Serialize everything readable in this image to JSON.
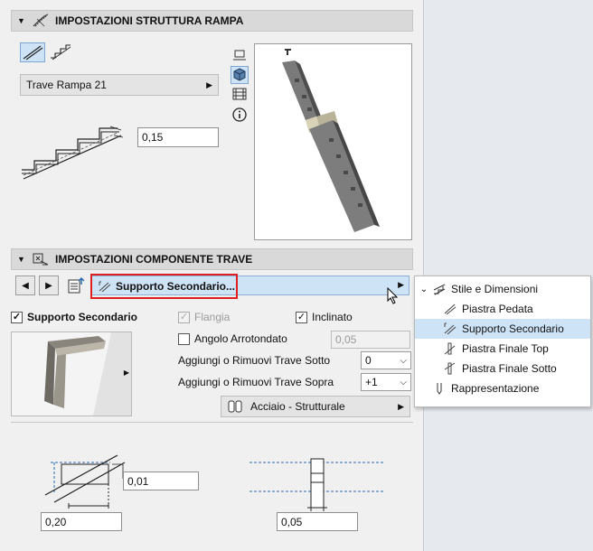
{
  "section1": {
    "title": "IMPOSTAZIONI STRUTTURA RAMPA",
    "preset_label": "Trave Rampa 21",
    "depth_value": "0,15"
  },
  "section2": {
    "title": "IMPOSTAZIONI COMPONENTE TRAVE",
    "component_select": "Supporto Secondario...",
    "highlight_color": "#e02020",
    "main_checkbox": {
      "label": "Supporto Secondario",
      "checked": true
    },
    "flangia": {
      "label": "Flangia",
      "checked": true,
      "disabled": true
    },
    "inclinato": {
      "label": "Inclinato",
      "checked": true
    },
    "angolo": {
      "label": "Angolo Arrotondato",
      "checked": false,
      "value": "0,05"
    },
    "trave_sotto": {
      "label": "Aggiungi o Rimuovi Trave Sotto",
      "value": "0"
    },
    "trave_sopra": {
      "label": "Aggiungi o Rimuovi Trave Sopra",
      "value": "+1"
    },
    "material": "Acciaio - Strutturale",
    "dim_top": "0,01",
    "dim_bottom_left": "0,20",
    "dim_bottom_right": "0,05"
  },
  "menu": {
    "header": "Stile e Dimensioni",
    "items": [
      {
        "label": "Piastra Pedata",
        "icon": "tread-plate-icon",
        "selected": false
      },
      {
        "label": "Supporto Secondario",
        "icon": "secondary-support-icon",
        "selected": true
      },
      {
        "label": "Piastra Finale Top",
        "icon": "end-plate-top-icon",
        "selected": false
      },
      {
        "label": "Piastra Finale Sotto",
        "icon": "end-plate-bottom-icon",
        "selected": false
      }
    ],
    "footer": "Rappresentazione"
  }
}
